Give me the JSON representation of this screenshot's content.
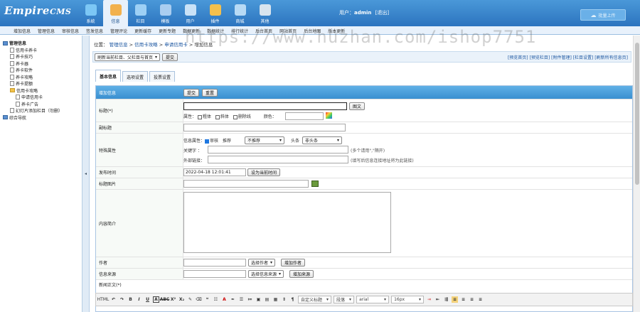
{
  "header": {
    "logo_main": "Empire",
    "logo_sub": "CMS",
    "nav": [
      {
        "label": "系统",
        "icon": "system-icon",
        "color": "#7cc7f5"
      },
      {
        "label": "信息",
        "icon": "info-edit-icon",
        "color": "#f2b14d"
      },
      {
        "label": "栏目",
        "icon": "column-icon",
        "color": "#9dd0f5"
      },
      {
        "label": "模板",
        "icon": "template-icon",
        "color": "#a9cdf0"
      },
      {
        "label": "用户",
        "icon": "user-icon",
        "color": "#c9e2f7"
      },
      {
        "label": "插件",
        "icon": "plugin-tools-icon",
        "color": "#f4c04d"
      },
      {
        "label": "商城",
        "icon": "shop-cart-icon",
        "color": "#b7daf5"
      },
      {
        "label": "其他",
        "icon": "gear-icon",
        "color": "#d8e4ee"
      }
    ],
    "user_label": "用户：",
    "user_name": "admin",
    "logout": "[退出]",
    "upload_button": "批量上传"
  },
  "subnav": [
    "增加信息",
    "管理信息",
    "审核信息",
    "签发信息",
    "管理评论",
    "更新缓存",
    "更新专题",
    "数据更新",
    "数据统计",
    "排行统计",
    "后台首页",
    "网站首页",
    "后台地图",
    "版本更新"
  ],
  "sidebar": {
    "root": "管理信息",
    "items": [
      {
        "label": "信用卡养卡",
        "level": 1,
        "type": "page"
      },
      {
        "label": "养卡技巧",
        "level": 1,
        "type": "page"
      },
      {
        "label": "养卡器",
        "level": 1,
        "type": "page"
      },
      {
        "label": "养卡软件",
        "level": 1,
        "type": "page"
      },
      {
        "label": "养卡攻略",
        "level": 1,
        "type": "page"
      },
      {
        "label": "养卡提额",
        "level": 1,
        "type": "page"
      },
      {
        "label": "信用卡攻略",
        "level": 1,
        "type": "folder"
      },
      {
        "label": "申请信用卡",
        "level": 2,
        "type": "page"
      },
      {
        "label": "养卡广告",
        "level": 2,
        "type": "page"
      },
      {
        "label": "幻灯片添加栏目（勿删）",
        "level": 1,
        "type": "page"
      },
      {
        "label": "综合导航",
        "level": 0,
        "type": "folder"
      }
    ],
    "collapse_arrow": "◂"
  },
  "breadcrumb": {
    "prefix": "位置：",
    "links": [
      "管理信息",
      "信用卡攻略",
      "申请信用卡"
    ],
    "sep": " > ",
    "current": "增加信息"
  },
  "toolbar": {
    "refresh_select": "刷新当前栏目、父栏目与首页",
    "submit": "提交",
    "links": "[预览首页] [预览栏目] [附件管理] [栏目设置] [刷新所有信息页]"
  },
  "tabs": [
    "基本信息",
    "选项设置",
    "投票设置"
  ],
  "form": {
    "header_label": "增加信息",
    "header_submit": "提交",
    "header_reset": "重置",
    "title_label": "标题(*)",
    "title_pic_button": "图文",
    "attr_label": "属性：",
    "attr_bold": "粗体",
    "attr_italic": "斜体",
    "attr_strike": "删除线",
    "color_label": "颜色：",
    "subtitle_label": "副标题",
    "special_label": "特殊属性",
    "info_attr_label": "信息属性：",
    "check_label": "审核",
    "recommend_label": "推荐",
    "recommend_value": "不推荐",
    "headline_label": "头条",
    "headline_value": "非头条",
    "keyword_label": "关键字 ：",
    "keyword_hint": "(多个请用\",\"隔开)",
    "outlink_label": "外部链接：",
    "outlink_hint": "(填写后信息连接地址将为此链接)",
    "pubtime_label": "发布时间",
    "pubtime_value": "2022-04-18 12:01:41",
    "pubtime_button": "设为当前时间",
    "titlepic_label": "标题图片",
    "intro_label": "内容简介",
    "author_label": "作者",
    "author_select": "选择作者",
    "author_button": "增加作者",
    "source_label": "信息来源",
    "source_select": "选择信息来源",
    "source_button": "增加来源",
    "body_label": "新闻正文(*)"
  },
  "editor": {
    "format": "自定义标题",
    "paragraph": "段落",
    "font": "arial",
    "size": "16px"
  },
  "watermark": "https://www.huzhan.com/ishop7751"
}
